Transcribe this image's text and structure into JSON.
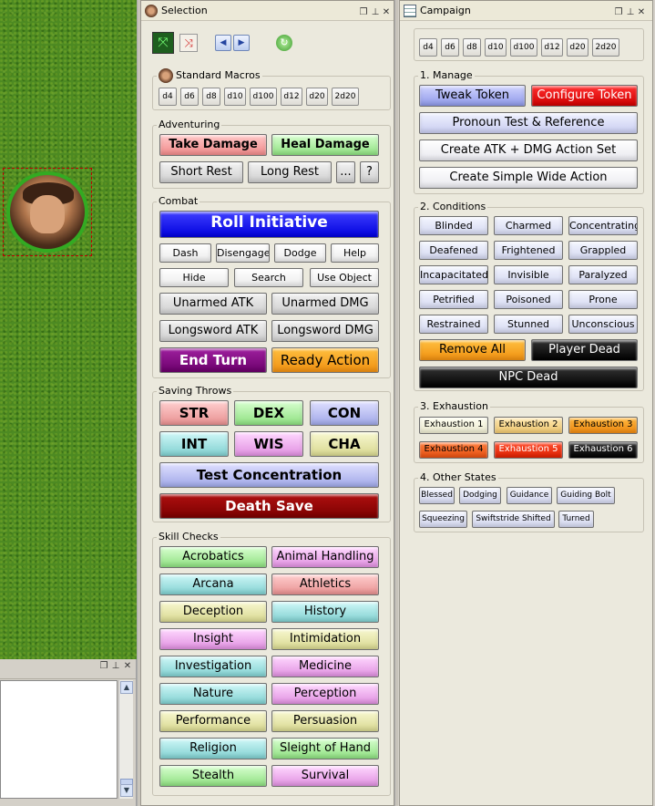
{
  "selection": {
    "title": "Selection",
    "standard_macros_label": "Standard Macros",
    "dice": [
      "d4",
      "d6",
      "d8",
      "d10",
      "d100",
      "d12",
      "d20",
      "2d20"
    ],
    "adventuring_label": "Adventuring",
    "take_damage": "Take Damage",
    "heal_damage": "Heal Damage",
    "short_rest": "Short Rest",
    "long_rest": "Long Rest",
    "more": "...",
    "help_q": "?",
    "combat_label": "Combat",
    "roll_initiative": "Roll Initiative",
    "actions": [
      "Dash",
      "Disengage",
      "Dodge",
      "Help",
      "Hide",
      "Search",
      "Use Object"
    ],
    "unarmed_atk": "Unarmed ATK",
    "unarmed_dmg": "Unarmed DMG",
    "longsword_atk": "Longsword ATK",
    "longsword_dmg": "Longsword DMG",
    "end_turn": "End Turn",
    "ready_action": "Ready Action",
    "saving_throws_label": "Saving Throws",
    "saves": [
      "STR",
      "DEX",
      "CON",
      "INT",
      "WIS",
      "CHA"
    ],
    "test_concentration": "Test Concentration",
    "death_save": "Death Save",
    "skill_checks_label": "Skill Checks",
    "skills": [
      "Acrobatics",
      "Animal Handling",
      "Arcana",
      "Athletics",
      "Deception",
      "History",
      "Insight",
      "Intimidation",
      "Investigation",
      "Medicine",
      "Nature",
      "Perception",
      "Performance",
      "Persuasion",
      "Religion",
      "Sleight of Hand",
      "Stealth",
      "Survival"
    ]
  },
  "campaign": {
    "title": "Campaign",
    "dice": [
      "d4",
      "d6",
      "d8",
      "d10",
      "d100",
      "d12",
      "d20",
      "2d20"
    ],
    "manage_label": "1. Manage",
    "tweak_token": "Tweak Token",
    "configure_token": "Configure Token",
    "pronoun_test": "Pronoun Test & Reference",
    "create_atk_dmg": "Create ATK + DMG Action Set",
    "create_simple": "Create Simple Wide Action",
    "conditions_label": "2. Conditions",
    "conditions": [
      "Blinded",
      "Charmed",
      "Concentrating",
      "Deafened",
      "Frightened",
      "Grappled",
      "Incapacitated",
      "Invisible",
      "Paralyzed",
      "Petrified",
      "Poisoned",
      "Prone",
      "Restrained",
      "Stunned",
      "Unconscious"
    ],
    "remove_all": "Remove All",
    "player_dead": "Player Dead",
    "npc_dead": "NPC Dead",
    "exhaustion_label": "3. Exhaustion",
    "exhaustion": [
      "Exhaustion 1",
      "Exhaustion 2",
      "Exhaustion 3",
      "Exhaustion 4",
      "Exhaustion 5",
      "Exhaustion 6"
    ],
    "other_states_label": "4. Other States",
    "other_states": [
      "Blessed",
      "Dodging",
      "Guidance",
      "Guiding Bolt",
      "Squeezing",
      "Swiftstride Shifted",
      "Turned"
    ]
  },
  "window_controls": {
    "restore": "❐",
    "pin": "⊥",
    "close": "✕"
  },
  "icons": [
    "token-portrait-icon",
    "select-all-icon",
    "deselect-icon",
    "previous-token-icon",
    "next-token-icon",
    "refresh-icon",
    "scroll-up-icon",
    "scroll-down-icon"
  ],
  "colors": {
    "grass": "#4d8a22",
    "token_ring": "#33aa22",
    "roll_initiative": "#1818e8",
    "end_turn": "#800080",
    "ready_action": "#f0a020",
    "death_save": "#8b0000",
    "configure_token": "#ee1111"
  }
}
